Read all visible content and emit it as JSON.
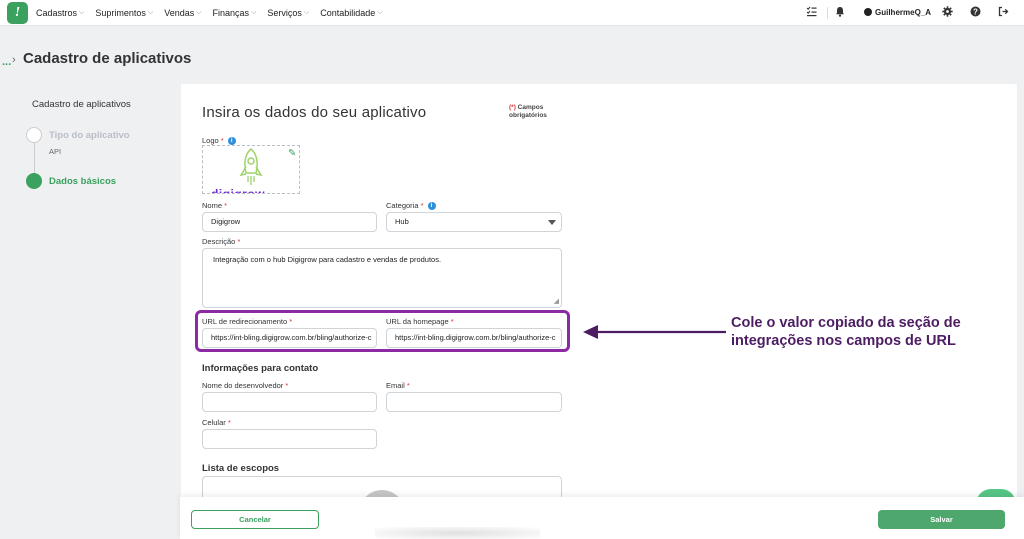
{
  "nav": {
    "menu": [
      "Cadastros",
      "Suprimentos",
      "Vendas",
      "Finanças",
      "Serviços",
      "Contabilidade"
    ],
    "user": "GuilhermeQ_A"
  },
  "header": {
    "breadcrumb_dots": "...",
    "title": "Cadastro de aplicativos"
  },
  "steps": {
    "title": "Cadastro de aplicativos",
    "items": [
      {
        "label": "Tipo do aplicativo",
        "sub": "API"
      },
      {
        "label": "Dados básicos",
        "sub": ""
      }
    ]
  },
  "form": {
    "title": "Insira os dados do seu aplicativo",
    "required_mark": "(*)",
    "required_note_1": "Campos",
    "required_note_2": "obrigatórios",
    "logo_label": "Logo",
    "logo_text": "digigrow",
    "name_label": "Nome",
    "name_value": "Digigrow",
    "category_label": "Categoria",
    "category_value": "Hub",
    "description_label": "Descrição",
    "description_value": "Integração com o hub Digigrow para cadastro e vendas de produtos.",
    "redirect_url_label": "URL de redirecionamento",
    "redirect_url_value": "https://int-bling.digigrow.com.br/bling/authorize-c",
    "homepage_url_label": "URL da homepage",
    "homepage_url_value": "https://int-bling.digigrow.com.br/bling/authorize-c",
    "contact_section": "Informações para contato",
    "developer_label": "Nome do desenvolvedor",
    "email_label": "Email",
    "phone_label": "Celular",
    "scopes_section": "Lista de escopos",
    "required_asterisk": "*",
    "info_glyph": "i"
  },
  "annotation": {
    "line1": "Cole o valor copiado da seção de",
    "line2": "integrações nos campos de URL",
    "color": "#4d1d63"
  },
  "footer": {
    "cancel": "Cancelar",
    "save": "Salvar"
  },
  "colors": {
    "brand": "#3aa15f",
    "highlight": "#8b2aa3",
    "required": "#d33333"
  }
}
